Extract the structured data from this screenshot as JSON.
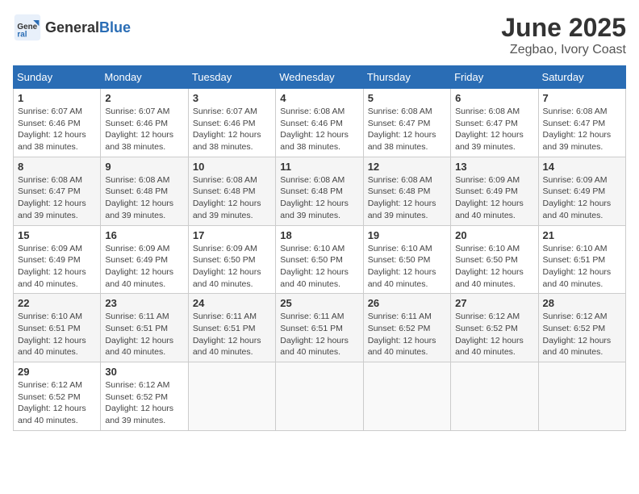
{
  "header": {
    "logo_general": "General",
    "logo_blue": "Blue",
    "title": "June 2025",
    "subtitle": "Zegbao, Ivory Coast"
  },
  "calendar": {
    "days_of_week": [
      "Sunday",
      "Monday",
      "Tuesday",
      "Wednesday",
      "Thursday",
      "Friday",
      "Saturday"
    ],
    "weeks": [
      [
        {
          "day": "",
          "info": ""
        },
        {
          "day": "2",
          "info": "Sunrise: 6:07 AM\nSunset: 6:46 PM\nDaylight: 12 hours\nand 38 minutes."
        },
        {
          "day": "3",
          "info": "Sunrise: 6:07 AM\nSunset: 6:46 PM\nDaylight: 12 hours\nand 38 minutes."
        },
        {
          "day": "4",
          "info": "Sunrise: 6:08 AM\nSunset: 6:46 PM\nDaylight: 12 hours\nand 38 minutes."
        },
        {
          "day": "5",
          "info": "Sunrise: 6:08 AM\nSunset: 6:47 PM\nDaylight: 12 hours\nand 38 minutes."
        },
        {
          "day": "6",
          "info": "Sunrise: 6:08 AM\nSunset: 6:47 PM\nDaylight: 12 hours\nand 39 minutes."
        },
        {
          "day": "7",
          "info": "Sunrise: 6:08 AM\nSunset: 6:47 PM\nDaylight: 12 hours\nand 39 minutes."
        }
      ],
      [
        {
          "day": "1",
          "info": "Sunrise: 6:07 AM\nSunset: 6:46 PM\nDaylight: 12 hours\nand 38 minutes."
        },
        {
          "day": "",
          "info": ""
        },
        {
          "day": "",
          "info": ""
        },
        {
          "day": "",
          "info": ""
        },
        {
          "day": "",
          "info": ""
        },
        {
          "day": "",
          "info": ""
        },
        {
          "day": "",
          "info": ""
        }
      ],
      [
        {
          "day": "8",
          "info": "Sunrise: 6:08 AM\nSunset: 6:47 PM\nDaylight: 12 hours\nand 39 minutes."
        },
        {
          "day": "9",
          "info": "Sunrise: 6:08 AM\nSunset: 6:48 PM\nDaylight: 12 hours\nand 39 minutes."
        },
        {
          "day": "10",
          "info": "Sunrise: 6:08 AM\nSunset: 6:48 PM\nDaylight: 12 hours\nand 39 minutes."
        },
        {
          "day": "11",
          "info": "Sunrise: 6:08 AM\nSunset: 6:48 PM\nDaylight: 12 hours\nand 39 minutes."
        },
        {
          "day": "12",
          "info": "Sunrise: 6:08 AM\nSunset: 6:48 PM\nDaylight: 12 hours\nand 39 minutes."
        },
        {
          "day": "13",
          "info": "Sunrise: 6:09 AM\nSunset: 6:49 PM\nDaylight: 12 hours\nand 40 minutes."
        },
        {
          "day": "14",
          "info": "Sunrise: 6:09 AM\nSunset: 6:49 PM\nDaylight: 12 hours\nand 40 minutes."
        }
      ],
      [
        {
          "day": "15",
          "info": "Sunrise: 6:09 AM\nSunset: 6:49 PM\nDaylight: 12 hours\nand 40 minutes."
        },
        {
          "day": "16",
          "info": "Sunrise: 6:09 AM\nSunset: 6:49 PM\nDaylight: 12 hours\nand 40 minutes."
        },
        {
          "day": "17",
          "info": "Sunrise: 6:09 AM\nSunset: 6:50 PM\nDaylight: 12 hours\nand 40 minutes."
        },
        {
          "day": "18",
          "info": "Sunrise: 6:10 AM\nSunset: 6:50 PM\nDaylight: 12 hours\nand 40 minutes."
        },
        {
          "day": "19",
          "info": "Sunrise: 6:10 AM\nSunset: 6:50 PM\nDaylight: 12 hours\nand 40 minutes."
        },
        {
          "day": "20",
          "info": "Sunrise: 6:10 AM\nSunset: 6:50 PM\nDaylight: 12 hours\nand 40 minutes."
        },
        {
          "day": "21",
          "info": "Sunrise: 6:10 AM\nSunset: 6:51 PM\nDaylight: 12 hours\nand 40 minutes."
        }
      ],
      [
        {
          "day": "22",
          "info": "Sunrise: 6:10 AM\nSunset: 6:51 PM\nDaylight: 12 hours\nand 40 minutes."
        },
        {
          "day": "23",
          "info": "Sunrise: 6:11 AM\nSunset: 6:51 PM\nDaylight: 12 hours\nand 40 minutes."
        },
        {
          "day": "24",
          "info": "Sunrise: 6:11 AM\nSunset: 6:51 PM\nDaylight: 12 hours\nand 40 minutes."
        },
        {
          "day": "25",
          "info": "Sunrise: 6:11 AM\nSunset: 6:51 PM\nDaylight: 12 hours\nand 40 minutes."
        },
        {
          "day": "26",
          "info": "Sunrise: 6:11 AM\nSunset: 6:52 PM\nDaylight: 12 hours\nand 40 minutes."
        },
        {
          "day": "27",
          "info": "Sunrise: 6:12 AM\nSunset: 6:52 PM\nDaylight: 12 hours\nand 40 minutes."
        },
        {
          "day": "28",
          "info": "Sunrise: 6:12 AM\nSunset: 6:52 PM\nDaylight: 12 hours\nand 40 minutes."
        }
      ],
      [
        {
          "day": "29",
          "info": "Sunrise: 6:12 AM\nSunset: 6:52 PM\nDaylight: 12 hours\nand 40 minutes."
        },
        {
          "day": "30",
          "info": "Sunrise: 6:12 AM\nSunset: 6:52 PM\nDaylight: 12 hours\nand 39 minutes."
        },
        {
          "day": "",
          "info": ""
        },
        {
          "day": "",
          "info": ""
        },
        {
          "day": "",
          "info": ""
        },
        {
          "day": "",
          "info": ""
        },
        {
          "day": "",
          "info": ""
        }
      ]
    ]
  }
}
